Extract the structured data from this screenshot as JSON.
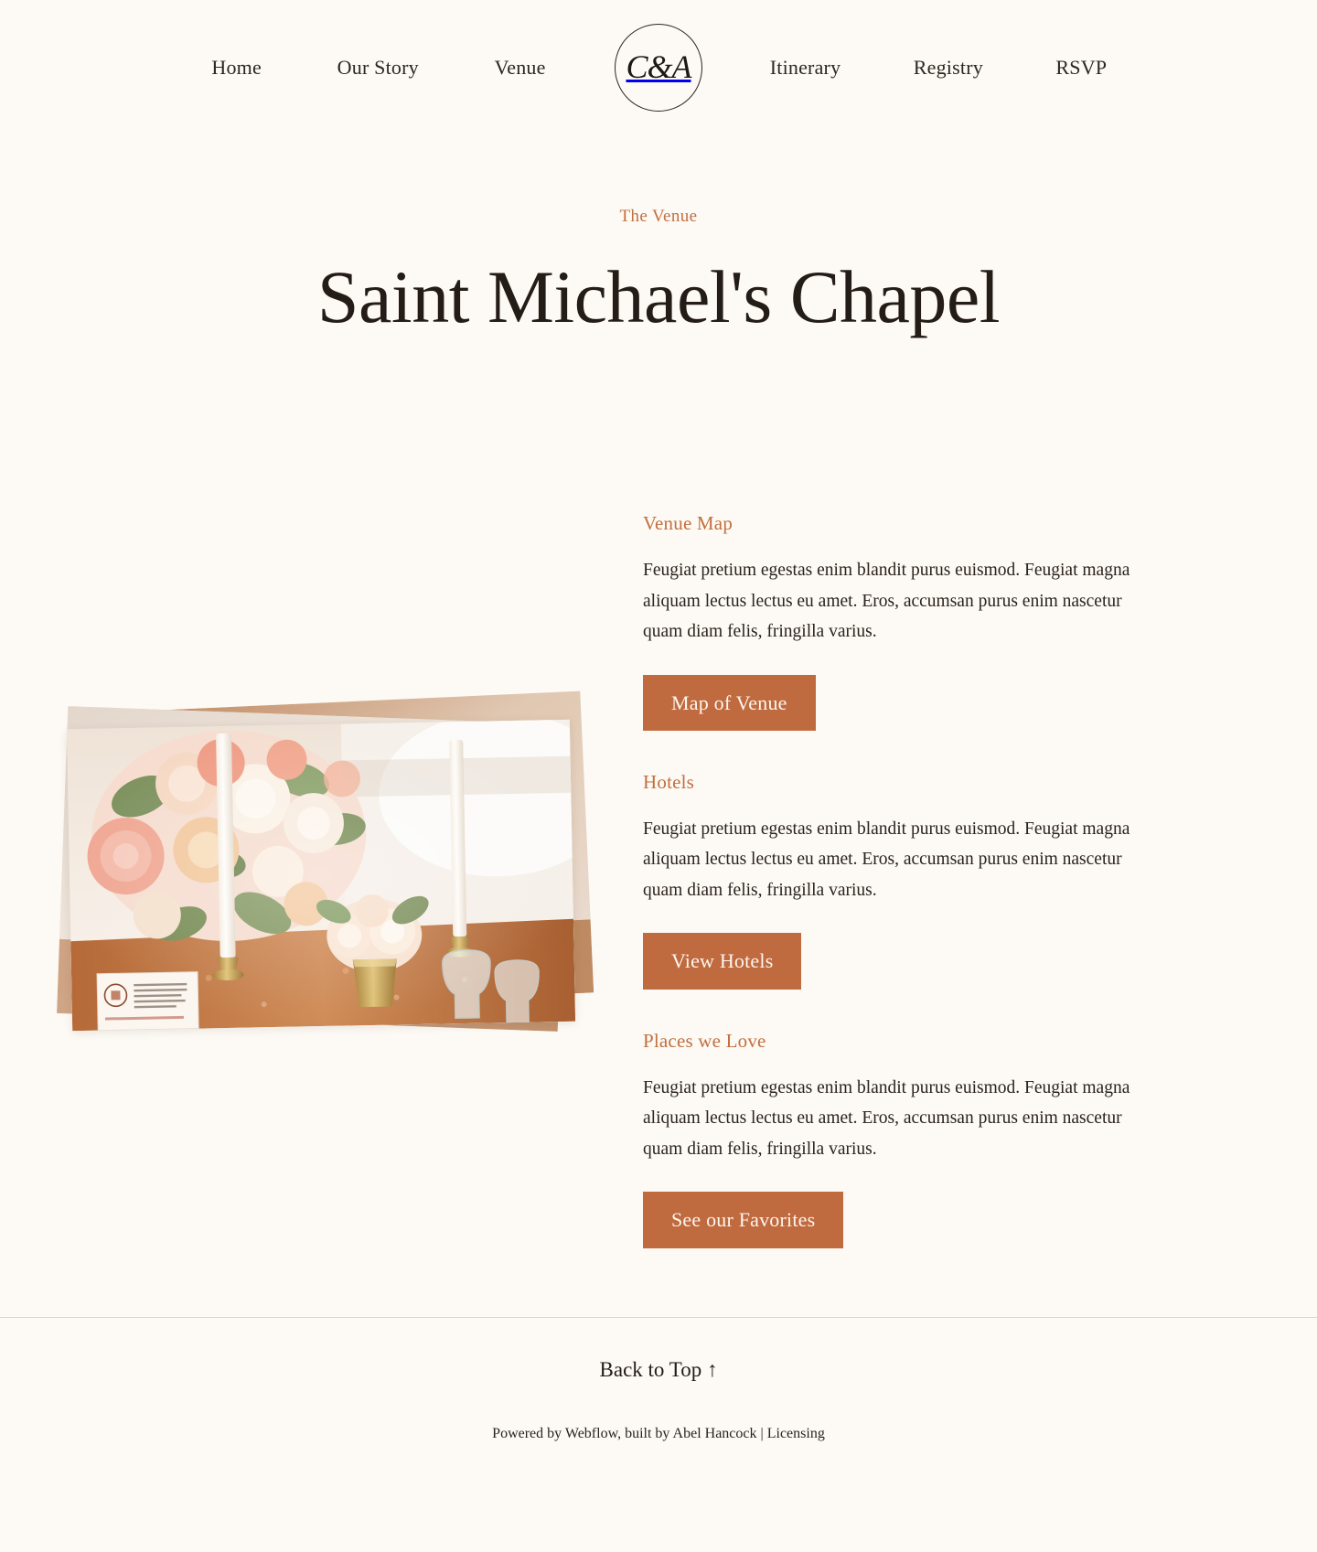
{
  "site": {
    "background_color": "#fdf9f4",
    "accent_color": "#c06a3f",
    "text_color": "#241c17"
  },
  "nav": {
    "logo_text": "C&A",
    "left_items": [
      {
        "label": "Home"
      },
      {
        "label": "Our Story"
      },
      {
        "label": "Venue"
      }
    ],
    "right_items": [
      {
        "label": "Itinerary"
      },
      {
        "label": "Registry"
      },
      {
        "label": "RSVP"
      }
    ]
  },
  "hero": {
    "eyebrow": "The Venue",
    "title": "Saint Michael's Chapel"
  },
  "gallery": {
    "alt": "Stacked photos of a wedding reception table with blush and peach floral centerpiece, tapered candles and glassware"
  },
  "sections": [
    {
      "title": "Venue Map",
      "body": "Feugiat pretium egestas enim blandit purus euismod. Feugiat magna aliquam lectus lectus eu amet. Eros, accumsan purus enim nascetur quam diam felis, fringilla varius.",
      "button": "Map of Venue"
    },
    {
      "title": "Hotels",
      "body": "Feugiat pretium egestas enim blandit purus euismod. Feugiat magna aliquam lectus lectus eu amet. Eros, accumsan purus enim nascetur quam diam felis, fringilla varius.",
      "button": "View Hotels"
    },
    {
      "title": "Places we Love",
      "body": "Feugiat pretium egestas enim blandit purus euismod. Feugiat magna aliquam lectus lectus eu amet. Eros, accumsan purus enim nascetur quam diam felis, fringilla varius.",
      "button": "See our Favorites"
    }
  ],
  "footer": {
    "back_to_top": "Back to Top ↑",
    "colophon_prefix": "Powered by ",
    "colophon_webflow": "Webflow",
    "colophon_middle": ", built by ",
    "colophon_author": "Abel Hancock",
    "colophon_separator": " | ",
    "colophon_licensing": "Licensing"
  }
}
